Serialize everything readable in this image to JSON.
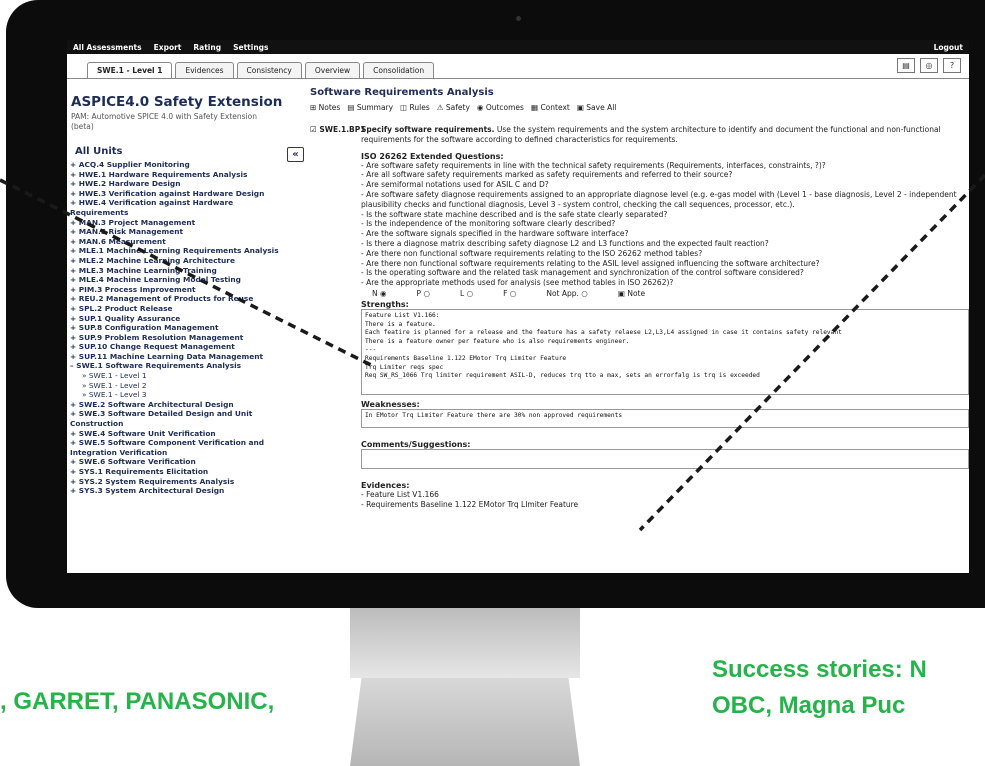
{
  "topbar": {
    "items": [
      "All Assessments",
      "Export",
      "Rating",
      "Settings"
    ],
    "logout": "Logout"
  },
  "tabs": [
    "SWE.1 - Level 1",
    "Evidences",
    "Consistency",
    "Overview",
    "Consolidation"
  ],
  "sidebar": {
    "title": "ASPICE4.0 Safety Extension",
    "subtitle": "PAM: Automotive SPICE 4.0 with Safety Extension (beta)",
    "units_title": "All Units",
    "collapse_label": "«",
    "units": [
      {
        "label": "+ ACQ.4 Supplier Monitoring",
        "sub": false
      },
      {
        "label": "+ HWE.1 Hardware Requirements Analysis",
        "sub": false
      },
      {
        "label": "+ HWE.2 Hardware Design",
        "sub": false
      },
      {
        "label": "+ HWE.3 Verification against Hardware Design",
        "sub": false
      },
      {
        "label": "+ HWE.4 Verification against Hardware Requirements",
        "sub": false
      },
      {
        "label": "+ MAN.3 Project Management",
        "sub": false
      },
      {
        "label": "+ MAN.5 Risk Management",
        "sub": false
      },
      {
        "label": "+ MAN.6 Measurement",
        "sub": false
      },
      {
        "label": "+ MLE.1 Machine Learning Requirements Analysis",
        "sub": false
      },
      {
        "label": "+ MLE.2 Machine Learning Architecture",
        "sub": false
      },
      {
        "label": "+ MLE.3 Machine Learning Training",
        "sub": false
      },
      {
        "label": "+ MLE.4 Machine Learning Model Testing",
        "sub": false
      },
      {
        "label": "+ PIM.3 Process Improvement",
        "sub": false
      },
      {
        "label": "+ REU.2 Management of Products for Reuse",
        "sub": false
      },
      {
        "label": "+ SPL.2 Product Release",
        "sub": false
      },
      {
        "label": "+ SUP.1 Quality Assurance",
        "sub": false
      },
      {
        "label": "+ SUP.8 Configuration Management",
        "sub": false
      },
      {
        "label": "+ SUP.9 Problem Resolution Management",
        "sub": false
      },
      {
        "label": "+ SUP.10 Change Request Management",
        "sub": false
      },
      {
        "label": "+ SUP.11 Machine Learning Data Management",
        "sub": false
      },
      {
        "label": "– SWE.1 Software Requirements Analysis",
        "sub": false
      },
      {
        "label": "» SWE.1 - Level 1",
        "sub": true
      },
      {
        "label": "» SWE.1 - Level 2",
        "sub": true
      },
      {
        "label": "» SWE.1 - Level 3",
        "sub": true
      },
      {
        "label": "+ SWE.2 Software Architectural Design",
        "sub": false
      },
      {
        "label": "+ SWE.3 Software Detailed Design and Unit Construction",
        "sub": false
      },
      {
        "label": "+ SWE.4 Software Unit Verification",
        "sub": false
      },
      {
        "label": "+ SWE.5 Software Component Verification and Integration Verification",
        "sub": false
      },
      {
        "label": "+ SWE.6 Software Verification",
        "sub": false
      },
      {
        "label": "+ SYS.1 Requirements Elicitation",
        "sub": false
      },
      {
        "label": "+ SYS.2 System Requirements Analysis",
        "sub": false
      },
      {
        "label": "+ SYS.3 System Architectural Design",
        "sub": false
      }
    ]
  },
  "main": {
    "title": "Software Requirements Analysis",
    "toolbar": [
      "⊞ Notes",
      "▤ Summary",
      "◫ Rules",
      "⚠ Safety",
      "◉ Outcomes",
      "▦ Context",
      "▣ Save All"
    ],
    "bp_id": "☑ SWE.1.BP1",
    "bp_bold": "Specify software requirements.",
    "bp_text": " Use the system requirements and the system architecture to identify and document the functional and non-functional requirements for the software according to defined characteristics for requirements.",
    "iso_title": "ISO 26262 Extended Questions:",
    "questions": [
      "- Are software safety requirements in line with the technical safety requirements (Requirements, interfaces, constraints, ?)?",
      "- Are all software safety requirements marked as safety requirements and referred to their source?",
      "- Are semiformal notations used for ASIL C and D?",
      "- Are software safety diagnose requirements assigned to an appropriate diagnose level (e.g. e-gas model with (Level 1 - base diagnosis, Level 2 - independent plausibility checks and functional diagnosis, Level 3 - system control, checking the call sequences, processor, etc.).",
      "- Is the software state machine described and is the safe state clearly separated?",
      "- Is the independence of the monitoring software clearly described?",
      "- Are the software signals specified in the hardware software interface?",
      "- Is there a diagnose matrix describing safety diagnose L2 and L3 functions and the expected fault reaction?",
      "- Are there non functional software requirements relating to the ISO 26262 method tables?",
      "- Are there non functional software requirements relating to the ASIL level assigned influencing the software architecture?",
      "- Is the operating software and the related task management and synchronization of the control software considered?",
      "- Are the appropriate methods used for analysis (see method tables in ISO 26262)?"
    ],
    "ratings": [
      "N ◉",
      "P ○",
      "L ○",
      "F ○",
      "Not App. ○",
      "▣ Note"
    ],
    "strengths_label": "Strengths:",
    "strengths_lines": [
      "Feature List V1.166:",
      "There is a feature.",
      "Each featire is planned for a release and the feature has a safety relaese L2,L3,L4 assigned in case it contains safety relevant",
      "There is a feature owner per feature who is also requirements engineer.",
      "---",
      "Requirements Baseline 1.122 EMotor Trq Limiter Feature",
      "Trq Limiter reqs spec",
      "Req SW_RS_1066 Trq limiter requirement ASIL-D, reduces trq tto a max, sets an errorfalg is trq is exceeded"
    ],
    "weaknesses_label": "Weaknesses:",
    "weaknesses_text": "In EMotor Trq Limiter Feature there are 30% non approved requirements",
    "comments_label": "Comments/Suggestions:",
    "evidences_label": "Evidences:",
    "evidences": [
      "- Feature List V1.166",
      "- Requirements Baseline 1.122 EMotor Trq LImiter Feature"
    ]
  },
  "slide": {
    "left_text": ", GARRET, PANASONIC,",
    "right_line1": "Success stories: N",
    "right_line2": "OBC, Magna Puc",
    "text_color": "#26b34a"
  }
}
